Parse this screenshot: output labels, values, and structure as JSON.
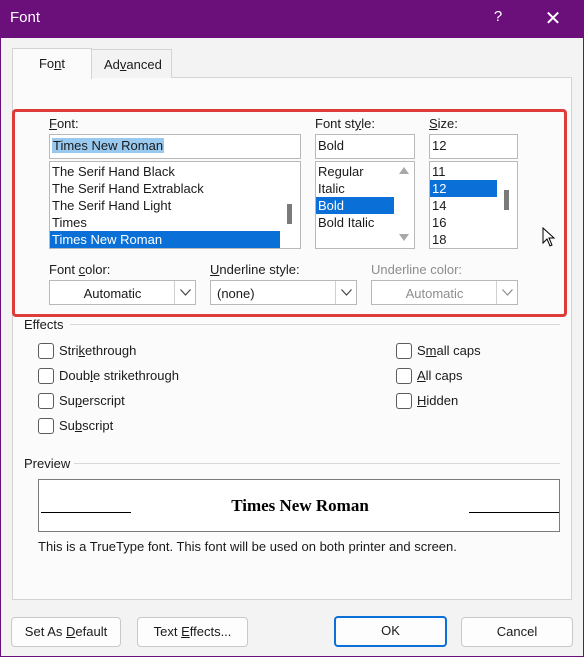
{
  "window": {
    "title": "Font",
    "help_glyph": "?",
    "close_glyph": "✕"
  },
  "tabs": [
    {
      "label_pre": "Fo",
      "label_u": "n",
      "label_post": "t"
    },
    {
      "label_pre": "Ad",
      "label_u": "v",
      "label_post": "anced"
    }
  ],
  "font": {
    "label_u": "F",
    "label_post": "ont:",
    "value": "Times New Roman",
    "items": [
      "The Serif Hand Black",
      "The Serif Hand Extrablack",
      "The Serif Hand Light",
      "Times",
      "Times New Roman"
    ],
    "selected_index": 4
  },
  "font_style": {
    "label_pre": "Font st",
    "label_u": "y",
    "label_post": "le:",
    "value": "Bold",
    "items": [
      "Regular",
      "Italic",
      "Bold",
      "Bold Italic"
    ],
    "selected_index": 2
  },
  "size": {
    "label_u": "S",
    "label_post": "ize:",
    "value": "12",
    "items": [
      "11",
      "12",
      "14",
      "16",
      "18"
    ],
    "selected_index": 1
  },
  "font_color": {
    "label_pre": "Font ",
    "label_u": "c",
    "label_post": "olor:",
    "value": "Automatic"
  },
  "underline_style": {
    "label_u": "U",
    "label_post": "nderline style:",
    "value": "(none)"
  },
  "underline_color": {
    "label_pre": "Underline color:",
    "value": "Automatic"
  },
  "effects": {
    "title": "Effects",
    "left": [
      {
        "pre": "Stri",
        "u": "k",
        "post": "ethrough",
        "checked": false
      },
      {
        "pre": "Doub",
        "u": "l",
        "post": "e strikethrough",
        "checked": false
      },
      {
        "pre": "Su",
        "u": "p",
        "post": "erscript",
        "checked": false
      },
      {
        "pre": "Su",
        "u": "b",
        "post": "script",
        "checked": false
      }
    ],
    "right": [
      {
        "pre": "S",
        "u": "m",
        "post": "all caps",
        "checked": false
      },
      {
        "pre": "",
        "u": "A",
        "post": "ll caps",
        "checked": false
      },
      {
        "pre": "",
        "u": "H",
        "post": "idden",
        "checked": false
      }
    ]
  },
  "preview": {
    "title": "Preview",
    "sample": "Times New Roman",
    "note": "This is a TrueType font. This font will be used on both printer and screen."
  },
  "buttons": {
    "set_default_pre": "Set As ",
    "set_default_u": "D",
    "set_default_post": "efault",
    "text_effects_pre": "Text ",
    "text_effects_u": "E",
    "text_effects_post": "ffects...",
    "ok": "OK",
    "cancel": "Cancel"
  },
  "colors": {
    "titlebar": "#6b0f7a",
    "selection": "#0a6fd6",
    "highlight_box": "#de3b3b"
  }
}
